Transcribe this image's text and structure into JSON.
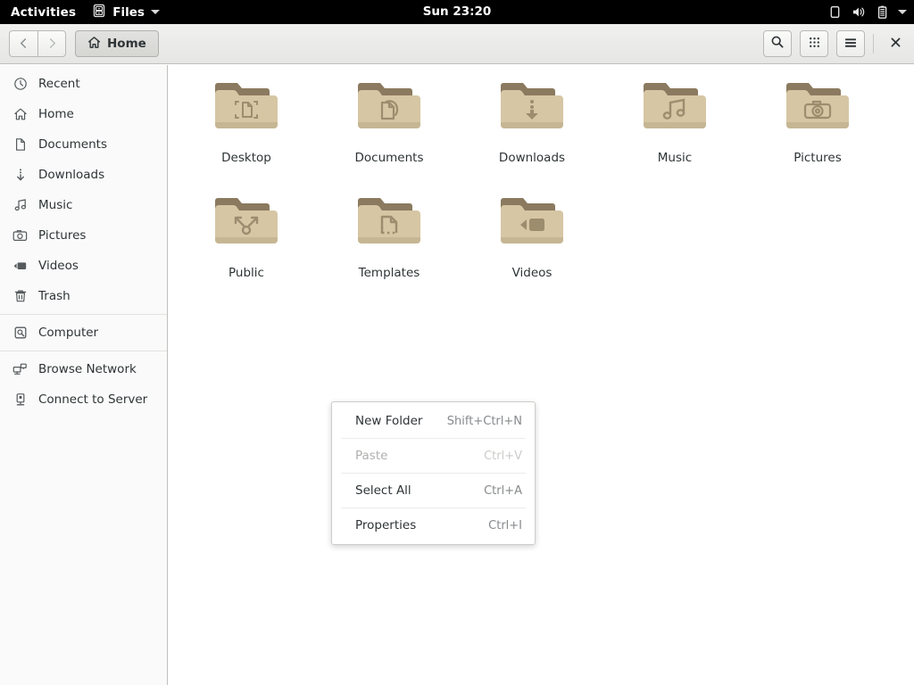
{
  "topbar": {
    "activities": "Activities",
    "app_icon": "files-cabinet-icon",
    "app_name": "Files",
    "app_menu_arrow": "chevron-down-icon",
    "clock": "Sun 23:20",
    "status_icons": [
      "display-icon",
      "volume-icon",
      "battery-icon",
      "chevron-down-icon"
    ]
  },
  "headerbar": {
    "back_icon": "chevron-left-icon",
    "forward_icon": "chevron-right-icon",
    "breadcrumb_icon": "home-icon",
    "breadcrumb_label": "Home",
    "search_icon": "search-icon",
    "view_grid_icon": "grid-view-icon",
    "menu_icon": "hamburger-menu-icon",
    "close_icon": "close-icon"
  },
  "sidebar": {
    "items": [
      {
        "label": "Recent",
        "icon": "clock-icon",
        "sep_after": false
      },
      {
        "label": "Home",
        "icon": "home-icon",
        "sep_after": false
      },
      {
        "label": "Documents",
        "icon": "document-icon",
        "sep_after": false
      },
      {
        "label": "Downloads",
        "icon": "download-icon",
        "sep_after": false
      },
      {
        "label": "Music",
        "icon": "music-note-icon",
        "sep_after": false
      },
      {
        "label": "Pictures",
        "icon": "camera-icon",
        "sep_after": false
      },
      {
        "label": "Videos",
        "icon": "video-icon",
        "sep_after": false
      },
      {
        "label": "Trash",
        "icon": "trash-icon",
        "sep_after": true
      },
      {
        "label": "Computer",
        "icon": "hard-drive-icon",
        "sep_after": true
      },
      {
        "label": "Browse Network",
        "icon": "network-icon",
        "sep_after": false
      },
      {
        "label": "Connect to Server",
        "icon": "server-icon",
        "sep_after": false
      }
    ]
  },
  "files": {
    "items": [
      {
        "name": "Desktop",
        "emblem": "desktop-emblem"
      },
      {
        "name": "Documents",
        "emblem": "documents-emblem"
      },
      {
        "name": "Downloads",
        "emblem": "downloads-emblem"
      },
      {
        "name": "Music",
        "emblem": "music-emblem"
      },
      {
        "name": "Pictures",
        "emblem": "pictures-emblem"
      },
      {
        "name": "Public",
        "emblem": "public-share-emblem"
      },
      {
        "name": "Templates",
        "emblem": "templates-emblem"
      },
      {
        "name": "Videos",
        "emblem": "videos-emblem"
      }
    ]
  },
  "context_menu": {
    "items": [
      {
        "label": "New Folder",
        "accel": "Shift+Ctrl+N",
        "disabled": false
      },
      {
        "label": "Paste",
        "accel": "Ctrl+V",
        "disabled": true
      },
      {
        "label": "Select All",
        "accel": "Ctrl+A",
        "disabled": false
      },
      {
        "label": "Properties",
        "accel": "Ctrl+I",
        "disabled": false
      }
    ]
  },
  "colors": {
    "topbar_bg": "#000000",
    "headerbar_bg": "#ebebea",
    "sidebar_bg": "#fafafa",
    "content_bg": "#ffffff",
    "folder_body": "#d6c6a4",
    "folder_tab": "#97866a",
    "folder_emblem": "#9d8d6f",
    "text": "#2e3436",
    "accel_text": "#878a8c"
  }
}
